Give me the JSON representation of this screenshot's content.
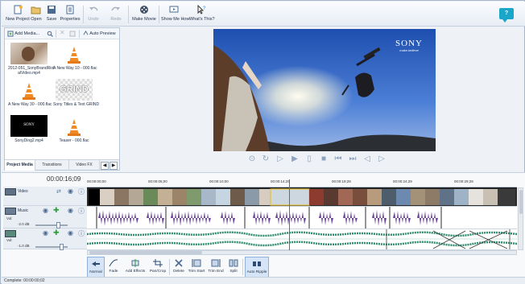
{
  "toolbar": {
    "new_project": "New Project",
    "open": "Open",
    "save": "Save",
    "properties": "Properties",
    "undo": "Undo",
    "redo": "Redo",
    "make_movie": "Make Movie",
    "show_me_how": "Show Me How",
    "whats_this": "What's This?",
    "help_badge": "?"
  },
  "media_panel": {
    "add_media": "Add Media...",
    "auto_preview": "Auto Preview",
    "items": [
      {
        "name": "2012-051_SonyBrandRiot\nalVideo.mp4"
      },
      {
        "name": "A New Way 10 - 000.flac"
      },
      {
        "name": "A New Way 30 - 000.flac"
      },
      {
        "name": "Sony Titles & Text GRIND"
      },
      {
        "name": "SonyDing2.mp4"
      },
      {
        "name": "Teaser - 000.flac"
      }
    ],
    "grind_text": "GRIND",
    "sony_text": "SONY",
    "tabs": [
      "Project Media",
      "Transitions",
      "Video FX"
    ]
  },
  "preview": {
    "sony_logo": "SONY",
    "sony_tagline": "make.believe"
  },
  "timeline": {
    "timecode": "00:00:16;09",
    "ruler_labels": [
      "00:00:00;00",
      "00:00:05;00",
      "00:00:10;00",
      "00:00:14;29",
      "00:00:19;29",
      "00:00:24;29",
      "00:00:29;29"
    ],
    "tracks": {
      "video": {
        "name": "Video"
      },
      "music": {
        "name": "Music",
        "vol_label": "Vol:",
        "vol_value": "-2.0 dB"
      },
      "audio": {
        "vol_label": "Vol:",
        "vol_value": "-1.0 dB"
      }
    }
  },
  "edit_toolbar": {
    "normal": "Normal",
    "fade": "Fade",
    "add_effects": "Add Effects",
    "pan_crop": "Pan/Crop",
    "delete": "Delete",
    "trim_start": "Trim Start",
    "trim_end": "Trim End",
    "split": "Split",
    "auto_ripple": "Auto Ripple"
  },
  "status": {
    "text": "Complete: 00:00:00;02"
  },
  "colors": {
    "accent": "#3b6fd1",
    "waveform_music": "#6a3fa0",
    "waveform_audio": "#2e8a6e"
  }
}
